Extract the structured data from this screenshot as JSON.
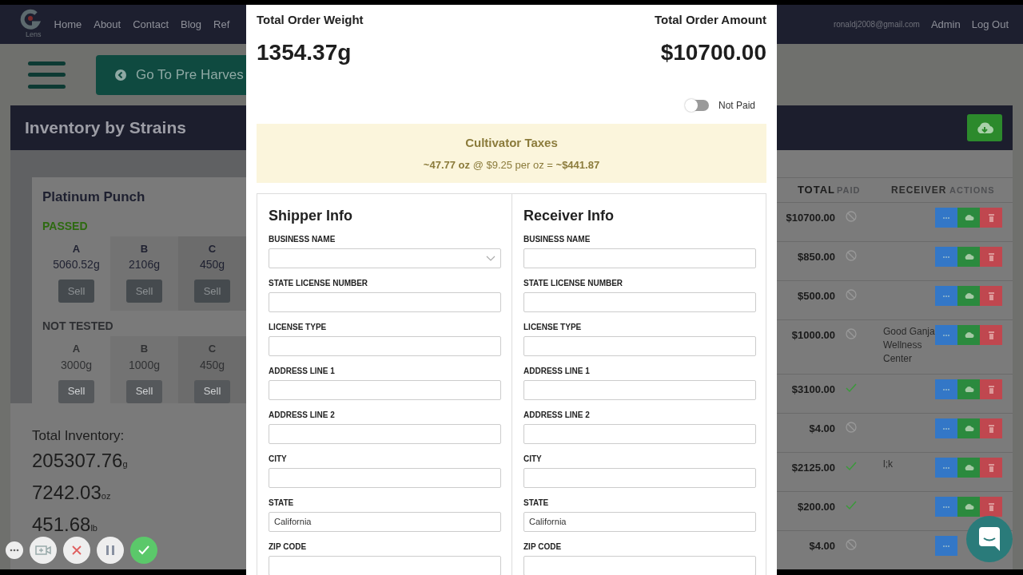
{
  "navbar": {
    "logo_text": "Lens",
    "links": [
      "Home",
      "About",
      "Contact",
      "Blog",
      "Ref"
    ],
    "email": "ronaldj2008@gmail.com",
    "right_links": [
      "Admin",
      "Log Out"
    ]
  },
  "back_button": {
    "label": "Go To Pre Harves"
  },
  "inventory": {
    "title": "Inventory by Strains"
  },
  "strain": {
    "name": "Platinum Punch",
    "groups": [
      {
        "status": "PASSED",
        "kind": "passed",
        "grades": [
          {
            "grade": "A",
            "weight": "5060.52g",
            "action": "Sell"
          },
          {
            "grade": "B",
            "weight": "2106g",
            "action": "Sell"
          },
          {
            "grade": "C",
            "weight": "450g",
            "action": "Sell"
          }
        ]
      },
      {
        "status": "NOT TESTED",
        "kind": "untested",
        "grades": [
          {
            "grade": "A",
            "weight": "3000g",
            "action": "Sell"
          },
          {
            "grade": "B",
            "weight": "1000g",
            "action": "Sell"
          },
          {
            "grade": "C",
            "weight": "450g",
            "action": "Sell"
          }
        ]
      }
    ]
  },
  "total_inventory": {
    "label": "Total Inventory:",
    "amounts": [
      {
        "value": "205307.76",
        "unit": "g"
      },
      {
        "value": "7242.03",
        "unit": "oz"
      },
      {
        "value": "451.68",
        "unit": "lb"
      }
    ]
  },
  "orders_table": {
    "columns": [
      "TOTAL",
      "PAID",
      "RECEIVER",
      "ACTIONS"
    ],
    "rows": [
      {
        "total": "$10700.00",
        "paid": false
      },
      {
        "total": "$850.00",
        "paid": false
      },
      {
        "total": "$500.00",
        "paid": false
      },
      {
        "total": "$1000.00",
        "paid": false,
        "receiver": "Good Ganja Wellness Center"
      },
      {
        "total": "$3100.00",
        "paid": true
      },
      {
        "total": "$4.00",
        "paid": false
      },
      {
        "total": "$2125.00",
        "paid": true,
        "receiver": "l;k"
      },
      {
        "total": "$200.00",
        "paid": true
      },
      {
        "total": "$4.00",
        "paid": false
      }
    ]
  },
  "modal": {
    "weight_label": "Total Order Weight",
    "weight": "1354.37g",
    "amount_label": "Total Order Amount",
    "amount": "$10700.00",
    "paid_toggle": {
      "label": "Not Paid",
      "on": false
    },
    "taxes": {
      "title": "Cultivator Taxes",
      "line": "**~47.77 oz** @ $9.25 per oz = **~$441.87**"
    },
    "sections": [
      {
        "title": "Shipper Info",
        "fields": [
          {
            "label": "BUSINESS NAME",
            "kind": "select"
          },
          {
            "label": "STATE LICENSE NUMBER",
            "kind": "text"
          },
          {
            "label": "LICENSE TYPE",
            "kind": "text"
          },
          {
            "label": "ADDRESS LINE 1",
            "kind": "text"
          },
          {
            "label": "ADDRESS LINE 2",
            "kind": "text"
          },
          {
            "label": "CITY",
            "kind": "text"
          },
          {
            "label": "STATE",
            "kind": "text",
            "value": "California"
          },
          {
            "label": "ZIP CODE",
            "kind": "text"
          }
        ]
      },
      {
        "title": "Receiver Info",
        "fields": [
          {
            "label": "BUSINESS NAME",
            "kind": "text"
          },
          {
            "label": "STATE LICENSE NUMBER",
            "kind": "text"
          },
          {
            "label": "LICENSE TYPE",
            "kind": "text"
          },
          {
            "label": "ADDRESS LINE 1",
            "kind": "text"
          },
          {
            "label": "ADDRESS LINE 2",
            "kind": "text"
          },
          {
            "label": "CITY",
            "kind": "text"
          },
          {
            "label": "STATE",
            "kind": "text",
            "value": "California"
          },
          {
            "label": "ZIP CODE",
            "kind": "text"
          }
        ]
      }
    ]
  }
}
